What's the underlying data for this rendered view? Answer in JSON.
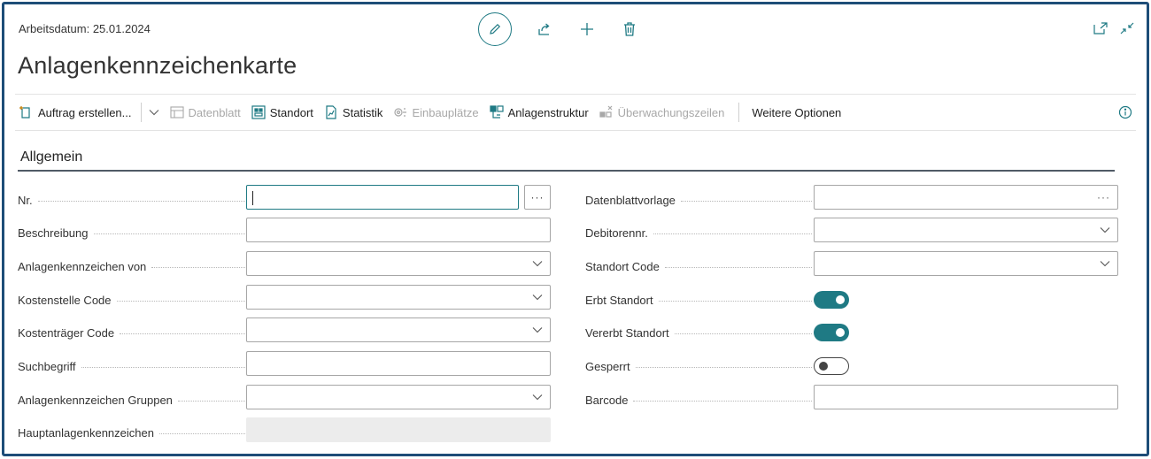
{
  "header": {
    "work_date": "Arbeitsdatum: 25.01.2024",
    "title": "Anlagenkennzeichenkarte"
  },
  "top_actions": [
    "edit-icon",
    "share-icon",
    "new-icon",
    "delete-icon"
  ],
  "corner_actions": [
    "open-new-window-icon",
    "collapse-icon"
  ],
  "toolbar": {
    "items": [
      {
        "label": "Auftrag erstellen...",
        "icon": "new-document-icon",
        "enabled": true
      },
      {
        "label": "Datenblatt",
        "icon": "datasheet-icon",
        "enabled": false
      },
      {
        "label": "Standort",
        "icon": "location-icon",
        "enabled": true
      },
      {
        "label": "Statistik",
        "icon": "statistics-icon",
        "enabled": true
      },
      {
        "label": "Einbauplätze",
        "icon": "installation-slots-icon",
        "enabled": false
      },
      {
        "label": "Anlagenstruktur",
        "icon": "structure-icon",
        "enabled": true
      },
      {
        "label": "Überwachungszeilen",
        "icon": "monitoring-icon",
        "enabled": false
      },
      {
        "label": "Weitere Optionen",
        "icon": "",
        "enabled": true
      }
    ]
  },
  "section": {
    "title": "Allgemein"
  },
  "fields_left": [
    {
      "label": "Nr.",
      "value": "",
      "type": "text-assist"
    },
    {
      "label": "Beschreibung",
      "value": "",
      "type": "text"
    },
    {
      "label": "Anlagenkennzeichen von",
      "value": "",
      "type": "dropdown"
    },
    {
      "label": "Kostenstelle Code",
      "value": "",
      "type": "dropdown"
    },
    {
      "label": "Kostenträger Code",
      "value": "",
      "type": "dropdown"
    },
    {
      "label": "Suchbegriff",
      "value": "",
      "type": "text"
    },
    {
      "label": "Anlagenkennzeichen Gruppen",
      "value": "",
      "type": "dropdown"
    },
    {
      "label": "Hauptanlagenkennzeichen",
      "value": "",
      "type": "readonly"
    }
  ],
  "fields_right": [
    {
      "label": "Datenblattvorlage",
      "value": "",
      "type": "lookup"
    },
    {
      "label": "Debitorennr.",
      "value": "",
      "type": "dropdown"
    },
    {
      "label": "Standort Code",
      "value": "",
      "type": "dropdown"
    },
    {
      "label": "Erbt Standort",
      "value": true,
      "type": "toggle"
    },
    {
      "label": "Vererbt Standort",
      "value": true,
      "type": "toggle"
    },
    {
      "label": "Gesperrt",
      "value": false,
      "type": "toggle"
    },
    {
      "label": "Barcode",
      "value": "",
      "type": "text"
    }
  ],
  "colors": {
    "accent": "#1f7a84",
    "frame": "#1e4d78",
    "disabled_text": "#a8a8a8"
  }
}
